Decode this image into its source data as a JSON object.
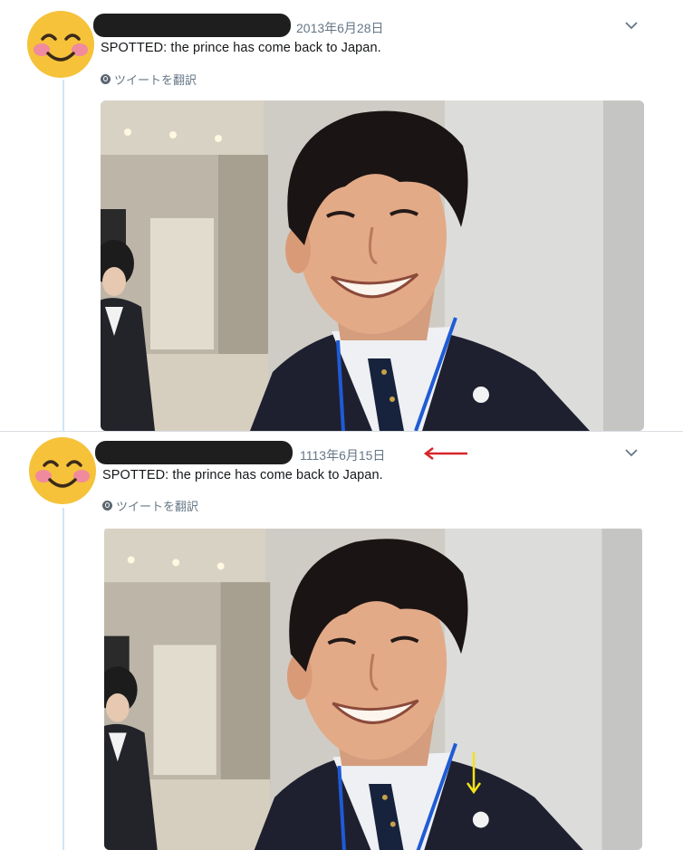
{
  "tweets": [
    {
      "date": "2013年6月28日",
      "text": "SPOTTED: the prince has come back to Japan.",
      "translate_label": "ツイートを翻訳"
    },
    {
      "date": "1113年6月15日",
      "text": "SPOTTED: the prince has come back to Japan.",
      "translate_label": "ツイートを翻訳"
    }
  ],
  "icons": {
    "avatar": "smiling-emoji-icon",
    "menu": "chevron-down-icon",
    "translate": "globe-icon",
    "annotation_1": "red-arrow-left-icon",
    "annotation_2": "yellow-arrow-down-icon"
  },
  "colors": {
    "annotation_red": "#d6262b",
    "annotation_yellow": "#f2e21b",
    "redaction": "#1e1e1e"
  }
}
